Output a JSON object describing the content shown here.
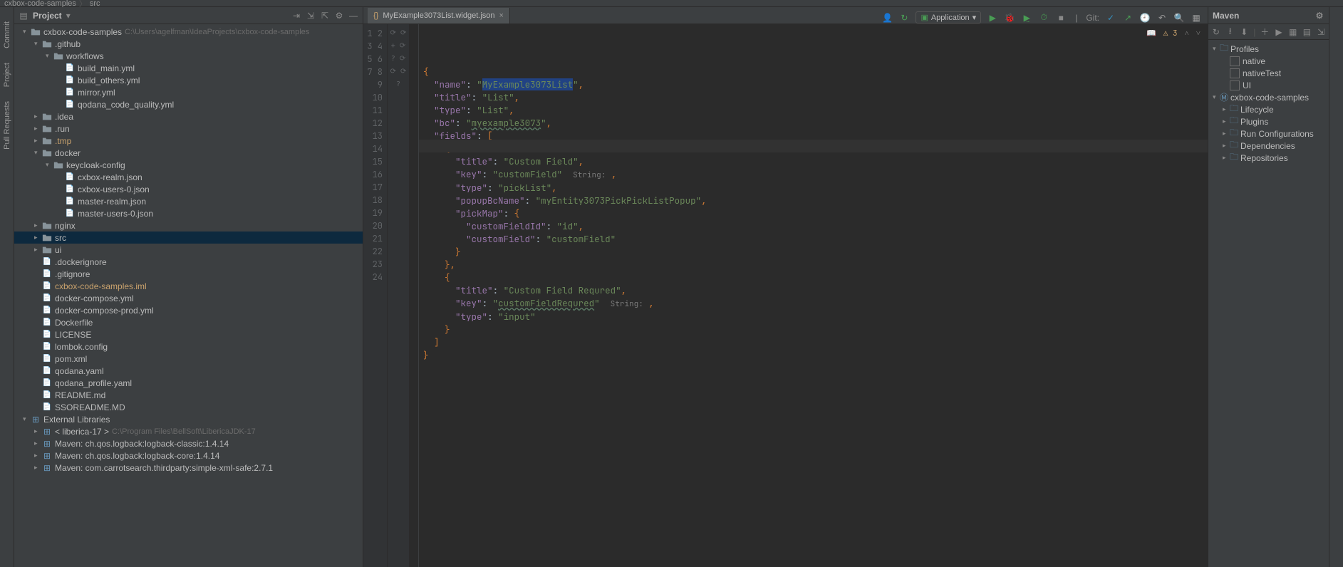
{
  "breadcrumb": {
    "project": "cxbox-code-samples",
    "folder": "src"
  },
  "toolbar": {
    "run_config": "Application",
    "git_label": "Git:"
  },
  "left_tools": {
    "commit": "Commit",
    "project": "Project",
    "pull_requests": "Pull Requests"
  },
  "project": {
    "title": "Project",
    "root": {
      "name": "cxbox-code-samples",
      "path": "C:\\Users\\agelfman\\IdeaProjects\\cxbox-code-samples"
    },
    "tree": [
      {
        "d": 0,
        "t": "root",
        "arrow": "▾",
        "name": "cxbox-code-samples",
        "detail": "C:\\Users\\agelfman\\IdeaProjects\\cxbox-code-samples"
      },
      {
        "d": 1,
        "t": "fold",
        "arrow": "▾",
        "name": ".github"
      },
      {
        "d": 2,
        "t": "fold",
        "arrow": "▾",
        "name": "workflows"
      },
      {
        "d": 3,
        "t": "file",
        "name": "build_main.yml"
      },
      {
        "d": 3,
        "t": "file",
        "name": "build_others.yml"
      },
      {
        "d": 3,
        "t": "file",
        "name": "mirror.yml"
      },
      {
        "d": 3,
        "t": "file",
        "name": "qodana_code_quality.yml"
      },
      {
        "d": 1,
        "t": "fold",
        "arrow": "▸",
        "name": ".idea"
      },
      {
        "d": 1,
        "t": "fold",
        "arrow": "▸",
        "name": ".run"
      },
      {
        "d": 1,
        "t": "fold",
        "arrow": "▸",
        "name": ".tmp",
        "hl": true
      },
      {
        "d": 1,
        "t": "fold",
        "arrow": "▾",
        "name": "docker"
      },
      {
        "d": 2,
        "t": "fold",
        "arrow": "▾",
        "name": "keycloak-config"
      },
      {
        "d": 3,
        "t": "file",
        "name": "cxbox-realm.json"
      },
      {
        "d": 3,
        "t": "file",
        "name": "cxbox-users-0.json"
      },
      {
        "d": 3,
        "t": "file",
        "name": "master-realm.json"
      },
      {
        "d": 3,
        "t": "file",
        "name": "master-users-0.json"
      },
      {
        "d": 1,
        "t": "fold",
        "arrow": "▸",
        "name": "nginx"
      },
      {
        "d": 1,
        "t": "fold",
        "arrow": "▸",
        "name": "src",
        "sel": true
      },
      {
        "d": 1,
        "t": "fold",
        "arrow": "▸",
        "name": "ui"
      },
      {
        "d": 1,
        "t": "file",
        "name": ".dockerignore"
      },
      {
        "d": 1,
        "t": "file",
        "name": ".gitignore"
      },
      {
        "d": 1,
        "t": "file",
        "name": "cxbox-code-samples.iml",
        "hl": true
      },
      {
        "d": 1,
        "t": "file",
        "name": "docker-compose.yml"
      },
      {
        "d": 1,
        "t": "file",
        "name": "docker-compose-prod.yml"
      },
      {
        "d": 1,
        "t": "file",
        "name": "Dockerfile"
      },
      {
        "d": 1,
        "t": "file",
        "name": "LICENSE"
      },
      {
        "d": 1,
        "t": "file",
        "name": "lombok.config"
      },
      {
        "d": 1,
        "t": "file",
        "name": "pom.xml"
      },
      {
        "d": 1,
        "t": "file",
        "name": "qodana.yaml"
      },
      {
        "d": 1,
        "t": "file",
        "name": "qodana_profile.yaml"
      },
      {
        "d": 1,
        "t": "file",
        "name": "README.md"
      },
      {
        "d": 1,
        "t": "file",
        "name": "SSOREADME.MD"
      },
      {
        "d": 0,
        "t": "lib",
        "arrow": "▾",
        "name": "External Libraries"
      },
      {
        "d": 1,
        "t": "lib",
        "arrow": "▸",
        "name": "< liberica-17 >",
        "detail": "C:\\Program Files\\BellSoft\\LibericaJDK-17"
      },
      {
        "d": 1,
        "t": "lib",
        "arrow": "▸",
        "name": "Maven: ch.qos.logback:logback-classic:1.4.14"
      },
      {
        "d": 1,
        "t": "lib",
        "arrow": "▸",
        "name": "Maven: ch.qos.logback:logback-core:1.4.14"
      },
      {
        "d": 1,
        "t": "lib",
        "arrow": "▸",
        "name": "Maven: com.carrotsearch.thirdparty:simple-xml-safe:2.7.1"
      }
    ]
  },
  "editor": {
    "tab": "MyExample3073List.widget.json",
    "status_warn": "⚠ 3",
    "lines": 24,
    "code": {
      "l1": "{",
      "l2_k": "name",
      "l2_v": "MyExample3073List",
      "l3_k": "title",
      "l3_v": "List",
      "l4_k": "type",
      "l4_v": "List",
      "l5_k": "bc",
      "l5_v": "myexample3073",
      "l6_k": "fields",
      "l8_k": "title",
      "l8_v": "Custom Field",
      "l9_k": "key",
      "l9_v": "customField",
      "l9_h": "String:",
      "l10_k": "type",
      "l10_v": "pickList",
      "l11_k": "popupBcName",
      "l11_v": "myEntity3073PickPickListPopup",
      "l12_k": "pickMap",
      "l13_k": "customFieldId",
      "l13_v": "id",
      "l14_k": "customField",
      "l14_v": "customField",
      "l18_k": "title",
      "l18_v": "Custom Field Requred",
      "l19_k": "key",
      "l19_v": "customFieldRequred",
      "l19_h": "String:",
      "l20_k": "type",
      "l20_v": "input"
    }
  },
  "maven": {
    "title": "Maven",
    "profiles": "Profiles",
    "p1": "native",
    "p2": "nativeTest",
    "p3": "UI",
    "project": "cxbox-code-samples",
    "items": [
      "Lifecycle",
      "Plugins",
      "Run Configurations",
      "Dependencies",
      "Repositories"
    ]
  }
}
